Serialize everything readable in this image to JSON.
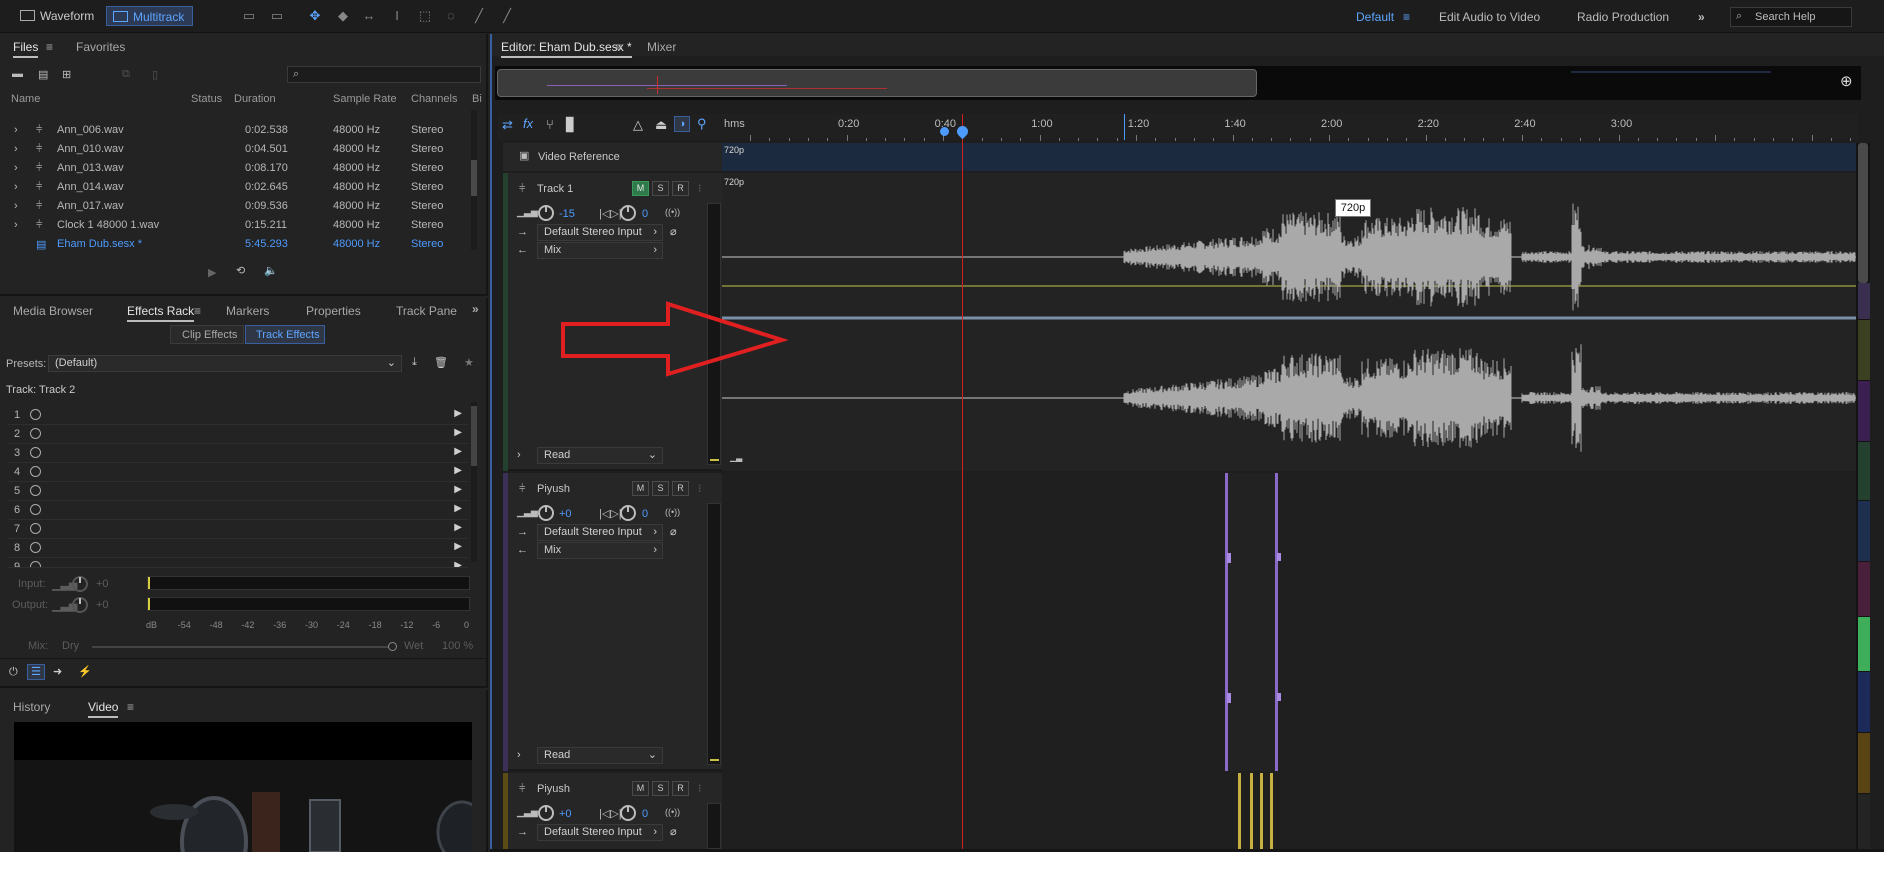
{
  "topbar": {
    "waveform_label": "Waveform",
    "multitrack_label": "Multitrack",
    "workspaces": [
      "Default",
      "Edit Audio to Video",
      "Radio Production"
    ],
    "search_placeholder": "Search Help"
  },
  "files_panel": {
    "tabs": [
      "Files",
      "Favorites"
    ],
    "columns": [
      "Name",
      "Status",
      "Duration",
      "Sample Rate",
      "Channels",
      "Bi"
    ],
    "rows": [
      {
        "name": "Ann_006.wav",
        "status": "",
        "duration": "0:02.538",
        "rate": "48000 Hz",
        "channels": "Stereo",
        "selected": false
      },
      {
        "name": "Ann_010.wav",
        "status": "",
        "duration": "0:04.501",
        "rate": "48000 Hz",
        "channels": "Stereo",
        "selected": false
      },
      {
        "name": "Ann_013.wav",
        "status": "",
        "duration": "0:08.170",
        "rate": "48000 Hz",
        "channels": "Stereo",
        "selected": false
      },
      {
        "name": "Ann_014.wav",
        "status": "",
        "duration": "0:02.645",
        "rate": "48000 Hz",
        "channels": "Stereo",
        "selected": false
      },
      {
        "name": "Ann_017.wav",
        "status": "",
        "duration": "0:09.536",
        "rate": "48000 Hz",
        "channels": "Stereo",
        "selected": false
      },
      {
        "name": "Clock 1 48000 1.wav",
        "status": "",
        "duration": "0:15.211",
        "rate": "48000 Hz",
        "channels": "Stereo",
        "selected": false
      },
      {
        "name": "Eham Dub.sesx *",
        "status": "",
        "duration": "5:45.293",
        "rate": "48000 Hz",
        "channels": "Stereo",
        "selected": true
      }
    ]
  },
  "effects_panel": {
    "tabs": [
      "Media Browser",
      "Effects Rack",
      "Markers",
      "Properties",
      "Track Pane"
    ],
    "subtabs": [
      "Clip Effects",
      "Track Effects"
    ],
    "presets_label": "Presets:",
    "presets_value": "(Default)",
    "track_label": "Track: Track 2",
    "slots": [
      "1",
      "2",
      "3",
      "4",
      "5",
      "6",
      "7",
      "8",
      "9"
    ],
    "input_label": "Input:",
    "input_value": "+0",
    "output_label": "Output:",
    "output_value": "+0",
    "db_scale": [
      "dB",
      "-54",
      "-48",
      "-42",
      "-36",
      "-30",
      "-24",
      "-18",
      "-12",
      "-6",
      "0"
    ],
    "mix_label": "Mix:",
    "dry_label": "Dry",
    "wet_label": "Wet",
    "wet_percent": "100 %"
  },
  "video_panel": {
    "tabs": [
      "History",
      "Video"
    ]
  },
  "editor": {
    "tab_label": "Editor: Eham Dub.sesx *",
    "mixer_label": "Mixer",
    "ruler_unit": "hms",
    "ruler_labels": [
      "0:20",
      "0:40",
      "1:00",
      "1:20",
      "1:40",
      "2:00",
      "2:20",
      "2:40",
      "3:00"
    ],
    "video_reference_label": "Video Reference",
    "video_clip_label": "720p",
    "tooltip": "720p",
    "playhead_time_fraction": 0.22
  },
  "tracks": [
    {
      "name": "Track 1",
      "mute_active": true,
      "volume": "-15",
      "pan": "0",
      "input": "Default Stereo Input",
      "output": "Mix",
      "automation": "Read",
      "color": "#2e4a38",
      "clip_label": "720p"
    },
    {
      "name": "Piyush",
      "mute_active": false,
      "volume": "+0",
      "pan": "0",
      "input": "Default Stereo Input",
      "output": "Mix",
      "automation": "Read",
      "color": "#4a3a6a"
    },
    {
      "name": "Piyush",
      "mute_active": false,
      "volume": "+0",
      "pan": "0",
      "input": "Default Stereo Input",
      "color": "#6a5a1e"
    }
  ],
  "track_buttons": {
    "m": "M",
    "s": "S",
    "r": "R"
  },
  "colors": {
    "accent": "#4e9bff",
    "panel_bg": "#232323",
    "waveform": "#a9a9a9",
    "playhead": "#d02020",
    "annotation_arrow": "#e02020"
  }
}
